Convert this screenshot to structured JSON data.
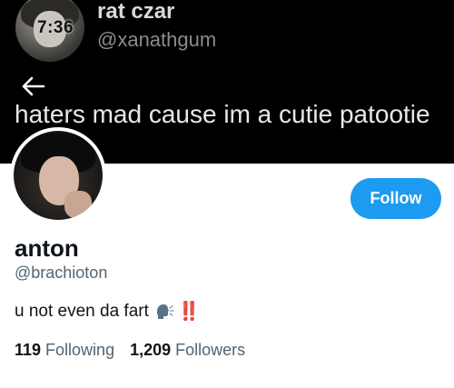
{
  "quoted_tweet": {
    "display_name": "rat czar",
    "handle": "@xanathgum",
    "time_overlay": "7:36",
    "text": "haters mad cause im a cutie patootie"
  },
  "profile": {
    "display_name": "anton",
    "handle": "@brachioton",
    "bio_text": "u not even da fart",
    "bio_emoji": "speaking-head-emoji",
    "bio_marks": "‼️",
    "follow_label": "Follow",
    "following_count": "119",
    "following_label": "Following",
    "followers_count": "1,209",
    "followers_label": "Followers"
  },
  "colors": {
    "accent": "#1d9bf0",
    "header_bg": "#000000",
    "secondary_text": "#536471",
    "alert_red": "#e0245e"
  },
  "icons": {
    "back": "arrow-left-icon",
    "emoji": "speaking-head-emoji"
  }
}
